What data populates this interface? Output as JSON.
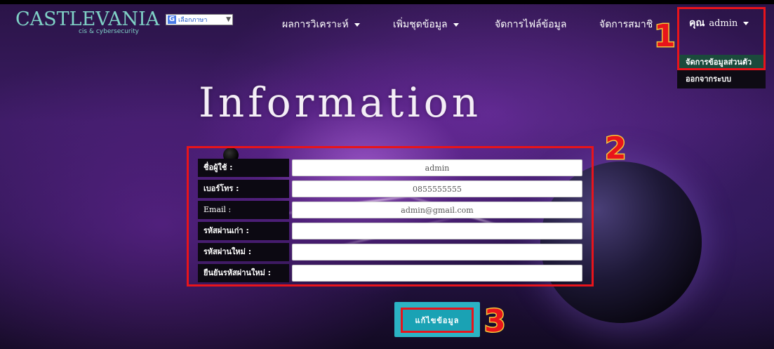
{
  "logo": {
    "main": "CASTLEVANIA",
    "sub": "cis & cybersecurity"
  },
  "language_selector": {
    "icon": "google-icon",
    "label": "เลือกภาษา",
    "caret": "▼"
  },
  "nav": {
    "items": [
      {
        "label": "ผลการวิเคราะห์",
        "has_dropdown": true
      },
      {
        "label": "เพิ่มชุดข้อมูล",
        "has_dropdown": true
      },
      {
        "label": "จัดการไฟล์ข้อมูล",
        "has_dropdown": false
      },
      {
        "label": "จัดการสมาชิ",
        "has_dropdown": false
      }
    ],
    "user": {
      "prefix": "คุณ",
      "name": "admin"
    },
    "user_dropdown": [
      {
        "label": "จัดการข้อมูลส่วนตัว",
        "active": true
      },
      {
        "label": "ออกจากระบบ",
        "active": false
      }
    ]
  },
  "page": {
    "heading": "Information"
  },
  "form": {
    "rows": [
      {
        "label": "ชื่อผู้ใช้ :",
        "value": "admin",
        "type": "text"
      },
      {
        "label": "เบอร์โทร :",
        "value": "0855555555",
        "type": "text"
      },
      {
        "label": "Email :",
        "value": "admin@gmail.com",
        "type": "text"
      },
      {
        "label": "รหัสผ่านเก่า :",
        "value": "",
        "type": "password"
      },
      {
        "label": "รหัสผ่านใหม่ :",
        "value": "",
        "type": "password"
      },
      {
        "label": "ยืนยันรหัสผ่านใหม่ :",
        "value": "",
        "type": "password"
      }
    ],
    "submit_label": "แก้ไขข้อมูล"
  },
  "annotations": {
    "marker_1": "1",
    "marker_2": "2",
    "marker_3": "3"
  },
  "colors": {
    "highlight": "#e8141b",
    "marker_outline": "#f5c53a",
    "button": "#1aa2b4",
    "active_menu": "#1b4a3c",
    "logo": "#7fd1c6"
  }
}
